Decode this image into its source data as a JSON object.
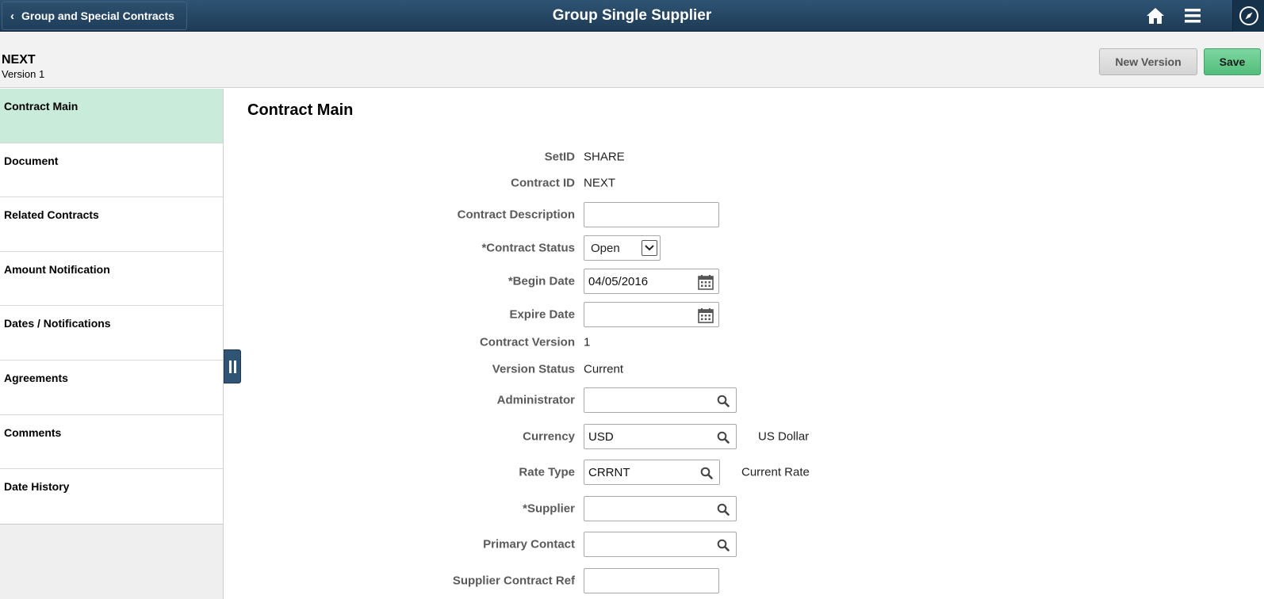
{
  "banner": {
    "back_label": "Group and Special Contracts",
    "title": "Group Single Supplier",
    "icons": [
      "home-icon",
      "menu-icon",
      "compass-icon"
    ]
  },
  "header": {
    "contract_name": "NEXT",
    "version": "Version 1",
    "new_version_label": "New Version",
    "save_label": "Save"
  },
  "sidebar": {
    "items": [
      {
        "label": "Contract Main",
        "active": true
      },
      {
        "label": "Document"
      },
      {
        "label": "Related Contracts"
      },
      {
        "label": "Amount Notification"
      },
      {
        "label": "Dates / Notifications"
      },
      {
        "label": "Agreements"
      },
      {
        "label": "Comments"
      },
      {
        "label": "Date History"
      }
    ]
  },
  "main": {
    "title": "Contract Main",
    "setid": {
      "label": "SetID",
      "value": "SHARE"
    },
    "contract_id": {
      "label": "Contract ID",
      "value": "NEXT"
    },
    "contract_description": {
      "label": "Contract Description",
      "value": ""
    },
    "contract_status": {
      "label": "*Contract Status",
      "value": "Open"
    },
    "begin_date": {
      "label": "*Begin Date",
      "value": "04/05/2016"
    },
    "expire_date": {
      "label": "Expire Date",
      "value": ""
    },
    "contract_version": {
      "label": "Contract Version",
      "value": "1"
    },
    "version_status": {
      "label": "Version Status",
      "value": "Current"
    },
    "administrator": {
      "label": "Administrator",
      "value": ""
    },
    "currency": {
      "label": "Currency",
      "value": "USD",
      "description": "US Dollar"
    },
    "rate_type": {
      "label": "Rate Type",
      "value": "CRRNT",
      "description": "Current Rate"
    },
    "supplier": {
      "label": "*Supplier",
      "value": ""
    },
    "primary_contact": {
      "label": "Primary Contact",
      "value": ""
    },
    "supplier_contract_ref": {
      "label": "Supplier Contract Ref",
      "value": ""
    }
  },
  "colors": {
    "banner": "#1d3b56",
    "active_item": "#c9ebd9",
    "save_button": "#52bd7b"
  }
}
